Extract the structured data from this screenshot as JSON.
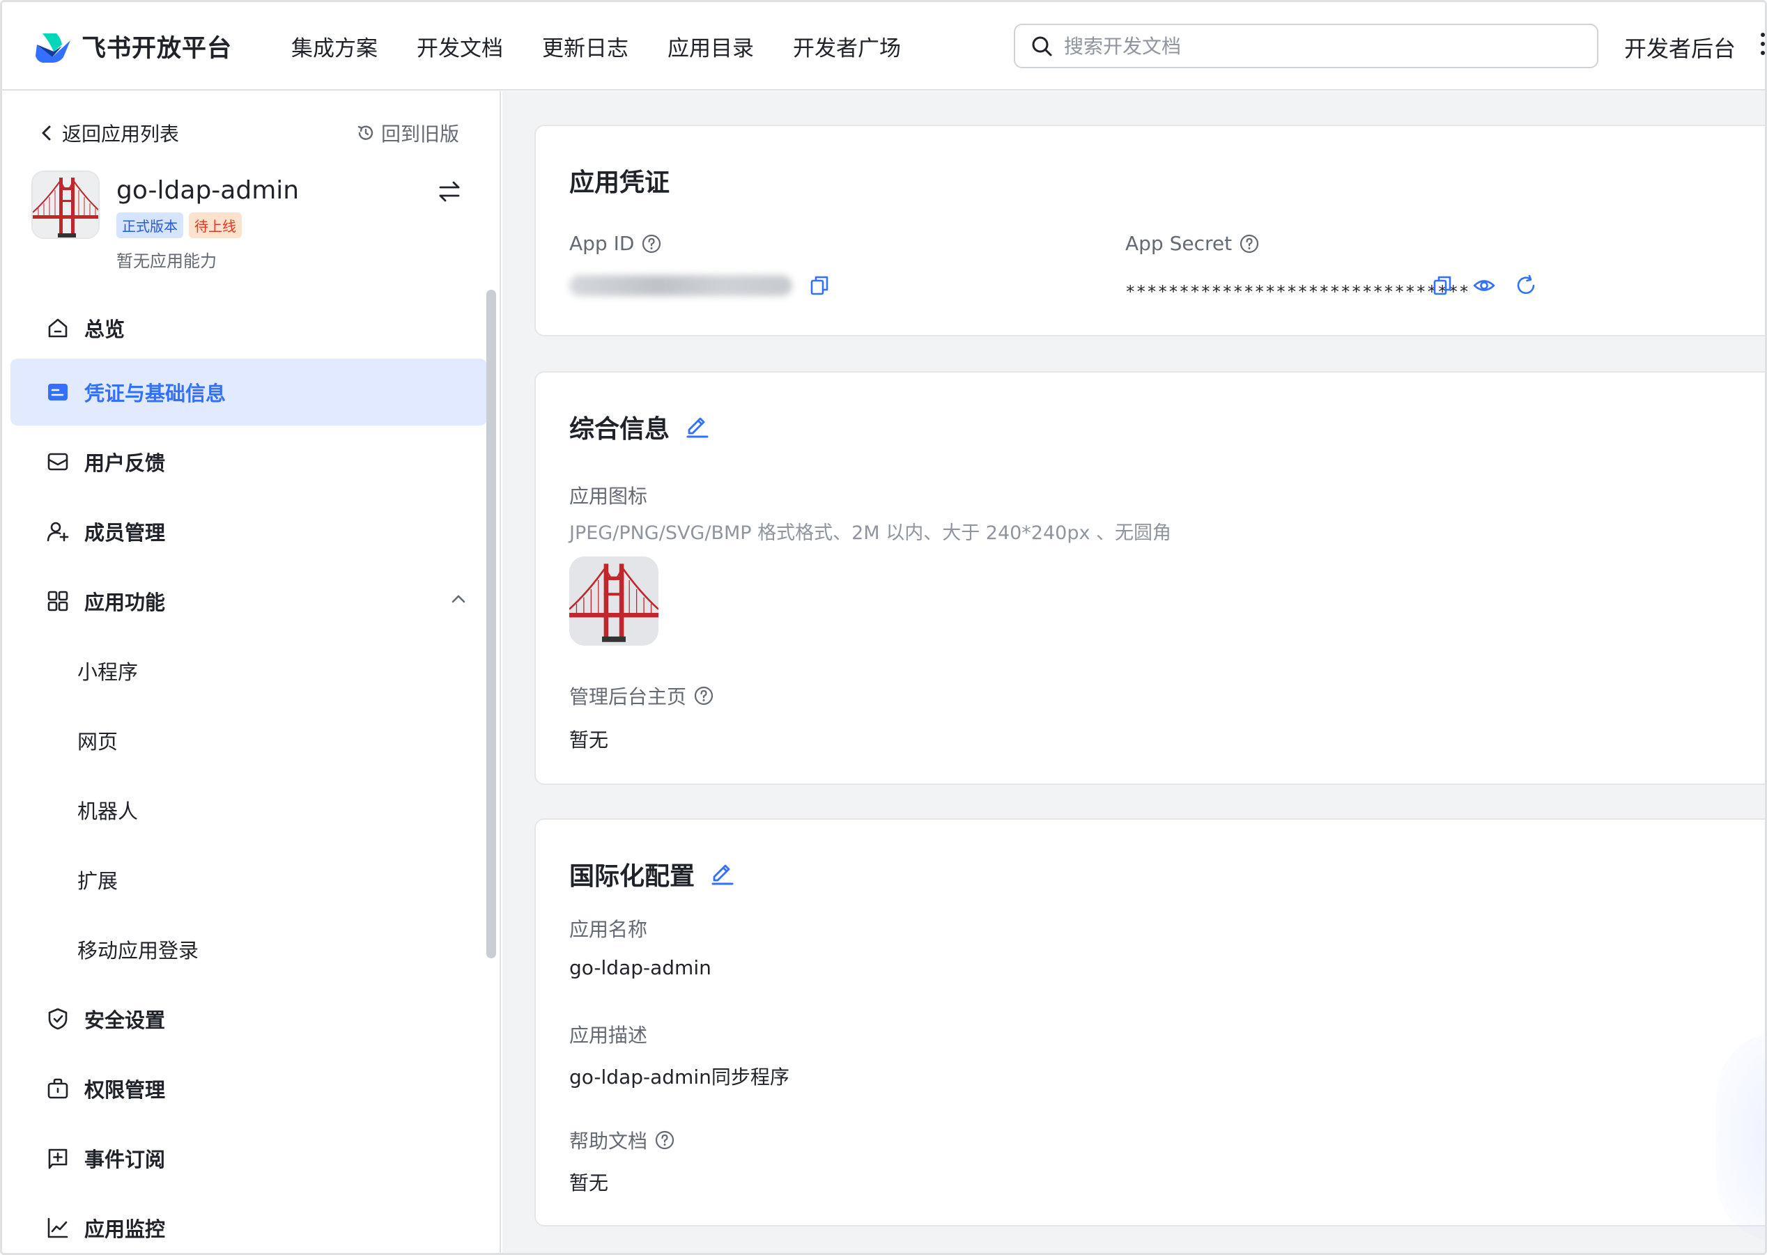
{
  "header": {
    "brand": "飞书开放平台",
    "nav": [
      "集成方案",
      "开发文档",
      "更新日志",
      "应用目录",
      "开发者广场"
    ],
    "search_placeholder": "搜索开发文档",
    "dev_backend": "开发者后台"
  },
  "sidebar": {
    "back_label": "返回应用列表",
    "old_version_label": "回到旧版",
    "app": {
      "name": "go-ldap-admin",
      "tags": [
        "正式版本",
        "待上线"
      ],
      "capability": "暂无应用能力"
    },
    "menu": {
      "overview": "总览",
      "credentials": "凭证与基础信息",
      "feedback": "用户反馈",
      "members": "成员管理",
      "features": "应用功能",
      "sub": [
        "小程序",
        "网页",
        "机器人",
        "扩展",
        "移动应用登录"
      ],
      "security": "安全设置",
      "permissions": "权限管理",
      "events": "事件订阅",
      "monitor": "应用监控"
    }
  },
  "credentials": {
    "title": "应用凭证",
    "app_id_label": "App ID",
    "app_secret_label": "App Secret",
    "app_secret_value": "********************************"
  },
  "general": {
    "title": "综合信息",
    "icon_label": "应用图标",
    "icon_hint": "JPEG/PNG/SVG/BMP 格式格式、2M 以内、大于 240*240px 、无圆角",
    "admin_home_label": "管理后台主页",
    "admin_home_value": "暂无"
  },
  "i18n": {
    "title": "国际化配置",
    "name_label": "应用名称",
    "name_value": "go-ldap-admin",
    "desc_label": "应用描述",
    "desc_value": "go-ldap-admin同步程序",
    "help_label": "帮助文档",
    "help_value": "暂无"
  },
  "colors": {
    "accent": "#3370ff",
    "active_bg": "#e1eaff",
    "page_bg": "#f2f3f5",
    "tag_blue_bg": "#d6e4ff",
    "tag_orange_bg": "#fde2ce"
  }
}
